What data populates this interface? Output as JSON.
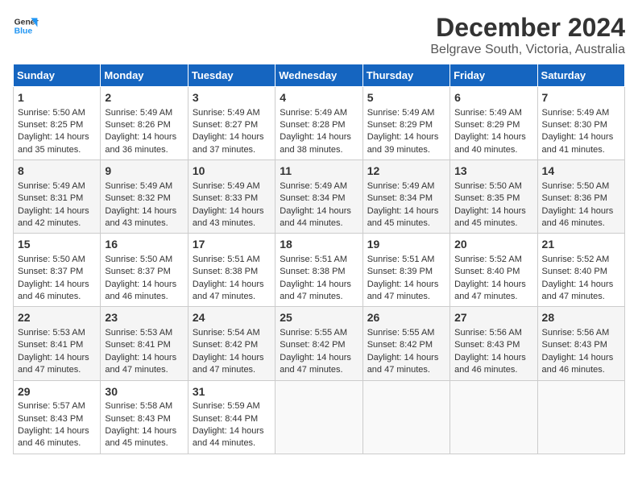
{
  "header": {
    "logo_line1": "General",
    "logo_line2": "Blue",
    "title": "December 2024",
    "subtitle": "Belgrave South, Victoria, Australia"
  },
  "calendar": {
    "days_of_week": [
      "Sunday",
      "Monday",
      "Tuesday",
      "Wednesday",
      "Thursday",
      "Friday",
      "Saturday"
    ],
    "weeks": [
      [
        {
          "day": "",
          "content": ""
        },
        {
          "day": "",
          "content": ""
        },
        {
          "day": "",
          "content": ""
        },
        {
          "day": "",
          "content": ""
        },
        {
          "day": "",
          "content": ""
        },
        {
          "day": "",
          "content": ""
        },
        {
          "day": "",
          "content": ""
        }
      ],
      [
        {
          "day": "1",
          "content": "Sunrise: 5:50 AM\nSunset: 8:25 PM\nDaylight: 14 hours and 35 minutes."
        },
        {
          "day": "2",
          "content": "Sunrise: 5:49 AM\nSunset: 8:26 PM\nDaylight: 14 hours and 36 minutes."
        },
        {
          "day": "3",
          "content": "Sunrise: 5:49 AM\nSunset: 8:27 PM\nDaylight: 14 hours and 37 minutes."
        },
        {
          "day": "4",
          "content": "Sunrise: 5:49 AM\nSunset: 8:28 PM\nDaylight: 14 hours and 38 minutes."
        },
        {
          "day": "5",
          "content": "Sunrise: 5:49 AM\nSunset: 8:29 PM\nDaylight: 14 hours and 39 minutes."
        },
        {
          "day": "6",
          "content": "Sunrise: 5:49 AM\nSunset: 8:29 PM\nDaylight: 14 hours and 40 minutes."
        },
        {
          "day": "7",
          "content": "Sunrise: 5:49 AM\nSunset: 8:30 PM\nDaylight: 14 hours and 41 minutes."
        }
      ],
      [
        {
          "day": "8",
          "content": "Sunrise: 5:49 AM\nSunset: 8:31 PM\nDaylight: 14 hours and 42 minutes."
        },
        {
          "day": "9",
          "content": "Sunrise: 5:49 AM\nSunset: 8:32 PM\nDaylight: 14 hours and 43 minutes."
        },
        {
          "day": "10",
          "content": "Sunrise: 5:49 AM\nSunset: 8:33 PM\nDaylight: 14 hours and 43 minutes."
        },
        {
          "day": "11",
          "content": "Sunrise: 5:49 AM\nSunset: 8:34 PM\nDaylight: 14 hours and 44 minutes."
        },
        {
          "day": "12",
          "content": "Sunrise: 5:49 AM\nSunset: 8:34 PM\nDaylight: 14 hours and 45 minutes."
        },
        {
          "day": "13",
          "content": "Sunrise: 5:50 AM\nSunset: 8:35 PM\nDaylight: 14 hours and 45 minutes."
        },
        {
          "day": "14",
          "content": "Sunrise: 5:50 AM\nSunset: 8:36 PM\nDaylight: 14 hours and 46 minutes."
        }
      ],
      [
        {
          "day": "15",
          "content": "Sunrise: 5:50 AM\nSunset: 8:37 PM\nDaylight: 14 hours and 46 minutes."
        },
        {
          "day": "16",
          "content": "Sunrise: 5:50 AM\nSunset: 8:37 PM\nDaylight: 14 hours and 46 minutes."
        },
        {
          "day": "17",
          "content": "Sunrise: 5:51 AM\nSunset: 8:38 PM\nDaylight: 14 hours and 47 minutes."
        },
        {
          "day": "18",
          "content": "Sunrise: 5:51 AM\nSunset: 8:38 PM\nDaylight: 14 hours and 47 minutes."
        },
        {
          "day": "19",
          "content": "Sunrise: 5:51 AM\nSunset: 8:39 PM\nDaylight: 14 hours and 47 minutes."
        },
        {
          "day": "20",
          "content": "Sunrise: 5:52 AM\nSunset: 8:40 PM\nDaylight: 14 hours and 47 minutes."
        },
        {
          "day": "21",
          "content": "Sunrise: 5:52 AM\nSunset: 8:40 PM\nDaylight: 14 hours and 47 minutes."
        }
      ],
      [
        {
          "day": "22",
          "content": "Sunrise: 5:53 AM\nSunset: 8:41 PM\nDaylight: 14 hours and 47 minutes."
        },
        {
          "day": "23",
          "content": "Sunrise: 5:53 AM\nSunset: 8:41 PM\nDaylight: 14 hours and 47 minutes."
        },
        {
          "day": "24",
          "content": "Sunrise: 5:54 AM\nSunset: 8:42 PM\nDaylight: 14 hours and 47 minutes."
        },
        {
          "day": "25",
          "content": "Sunrise: 5:55 AM\nSunset: 8:42 PM\nDaylight: 14 hours and 47 minutes."
        },
        {
          "day": "26",
          "content": "Sunrise: 5:55 AM\nSunset: 8:42 PM\nDaylight: 14 hours and 47 minutes."
        },
        {
          "day": "27",
          "content": "Sunrise: 5:56 AM\nSunset: 8:43 PM\nDaylight: 14 hours and 46 minutes."
        },
        {
          "day": "28",
          "content": "Sunrise: 5:56 AM\nSunset: 8:43 PM\nDaylight: 14 hours and 46 minutes."
        }
      ],
      [
        {
          "day": "29",
          "content": "Sunrise: 5:57 AM\nSunset: 8:43 PM\nDaylight: 14 hours and 46 minutes."
        },
        {
          "day": "30",
          "content": "Sunrise: 5:58 AM\nSunset: 8:43 PM\nDaylight: 14 hours and 45 minutes."
        },
        {
          "day": "31",
          "content": "Sunrise: 5:59 AM\nSunset: 8:44 PM\nDaylight: 14 hours and 44 minutes."
        },
        {
          "day": "",
          "content": ""
        },
        {
          "day": "",
          "content": ""
        },
        {
          "day": "",
          "content": ""
        },
        {
          "day": "",
          "content": ""
        }
      ]
    ]
  }
}
